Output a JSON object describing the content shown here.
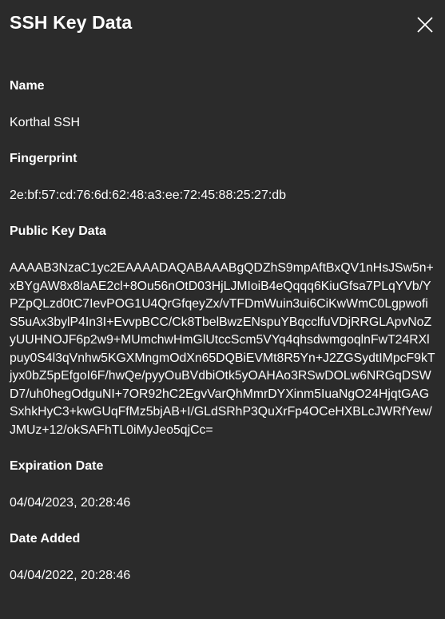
{
  "dialog": {
    "title": "SSH Key Data"
  },
  "icons": {
    "close": "close-icon"
  },
  "fields": {
    "name_label": "Name",
    "name_value": "Korthal SSH",
    "fingerprint_label": "Fingerprint",
    "fingerprint_value": "2e:bf:57:cd:76:6d:62:48:a3:ee:72:45:88:25:27:db",
    "public_key_label": "Public Key Data",
    "public_key_value": "AAAAB3NzaC1yc2EAAAADAQABAAABgQDZhS9mpAftBxQV1nHsJSw5n+xBYgAW8x8laAE2cl+8Ou56nOtD03HjLJMIoiB4eQqqq6KiuGfsa7PLqYVb/YPZpQLzd0tC7IevPOG1U4QrGfqeyZx/vTFDmWuin3ui6CiKwWmC0LgpwofiS5uAx3bylP4In3I+EvvpBCC/Ck8TbelBwzENspuYBqcclfuVDjRRGLApvNoZyUUHNOJF6p2w9+MUmchwHmGlUtccScm5VYq4qhsdwmgoqlnFwT24RXlpuy0S4l3qVnhw5KGXMngmOdXn65DQBiEVMt8R5Yn+J2ZGSydtIMpcF9kTjyx0bZ5pEfgoI6F/hwQe/pyyOuBVdbiOtk5yOAHAo3RSwDOLw6NRGqDSWD7/uh0hegOdguNI+7OR92hC2EgvVarQhMmrDYXinm5IuaNgO24HjqtGAGSxhkHyC3+kwGUqFfMz5bjAB+I/GLdSRhP3QuXrFp4OCeHXBLcJWRfYew/JMUz+12/okSAFhTL0iMyJeo5qjCc=",
    "expiration_label": "Expiration Date",
    "expiration_value": "04/04/2023, 20:28:46",
    "date_added_label": "Date Added",
    "date_added_value": "04/04/2022, 20:28:46"
  }
}
